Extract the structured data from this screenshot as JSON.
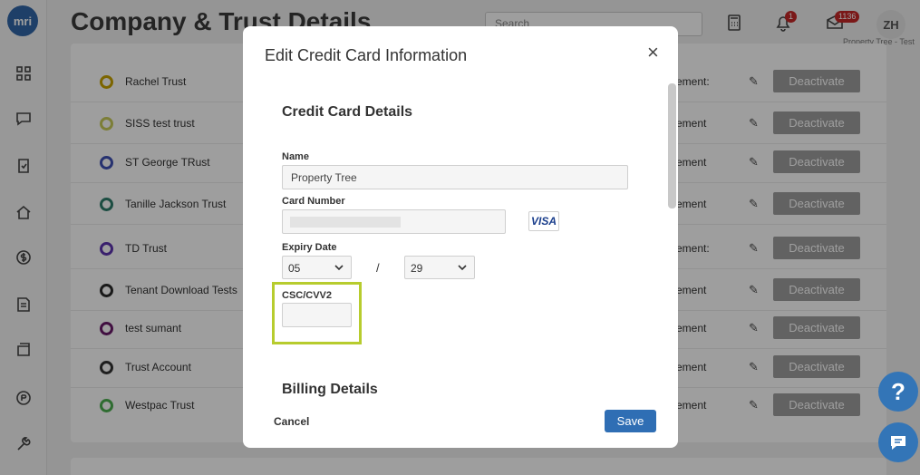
{
  "app": {
    "logo_text": "mri",
    "page_title": "Company & Trust Details",
    "search_placeholder": "Search",
    "notifications_count": "1",
    "messages_count": "1136",
    "avatar_initials": "ZH",
    "avatar_subtitle": "Property Tree - Test"
  },
  "trusts": [
    {
      "name": "Rachel Trust",
      "dot_color": "#c9a400",
      "ement": "ement:",
      "action": "Deactivate"
    },
    {
      "name": "SISS test trust",
      "dot_color": "#c8cc5a",
      "ement": "ement",
      "action": "Deactivate"
    },
    {
      "name": "ST George TRust",
      "dot_color": "#3f51b5",
      "ement": "ement",
      "action": "Deactivate"
    },
    {
      "name": "Tanille Jackson Trust",
      "dot_color": "#2e7d6b",
      "ement": "ement",
      "action": "Deactivate"
    },
    {
      "name": "TD Trust",
      "dot_color": "#5e35b1",
      "ement": "ement:",
      "action": "Deactivate"
    },
    {
      "name": "Tenant Download Tests",
      "dot_color": "#2b2b2b",
      "ement": "ement",
      "action": "Deactivate"
    },
    {
      "name": "test sumant",
      "dot_color": "#6a1b6a",
      "ement": "ement",
      "action": "Deactivate"
    },
    {
      "name": "Trust Account",
      "dot_color": "#333333",
      "ement": "ement",
      "action": "Deactivate"
    },
    {
      "name": "Westpac Trust",
      "dot_color": "#4caf50",
      "ement": "ement",
      "action": "Deactivate"
    }
  ],
  "help_label": "?",
  "modal": {
    "title": "Edit Credit Card Information",
    "close_glyph": "×",
    "card_section_heading": "Credit Card Details",
    "name_label": "Name",
    "name_value": "Property Tree",
    "card_number_label": "Card Number",
    "card_brand": "VISA",
    "expiry_label": "Expiry Date",
    "expiry_month": "05",
    "expiry_separator": "/",
    "expiry_year": "29",
    "csc_label": "CSC/CVV2",
    "csc_value": "",
    "billing_section_heading": "Billing Details",
    "cancel_label": "Cancel",
    "save_label": "Save"
  },
  "colors": {
    "primary": "#2f6eb4",
    "highlight": "#b7cc2e",
    "deactivate": "#9e9e9e"
  }
}
